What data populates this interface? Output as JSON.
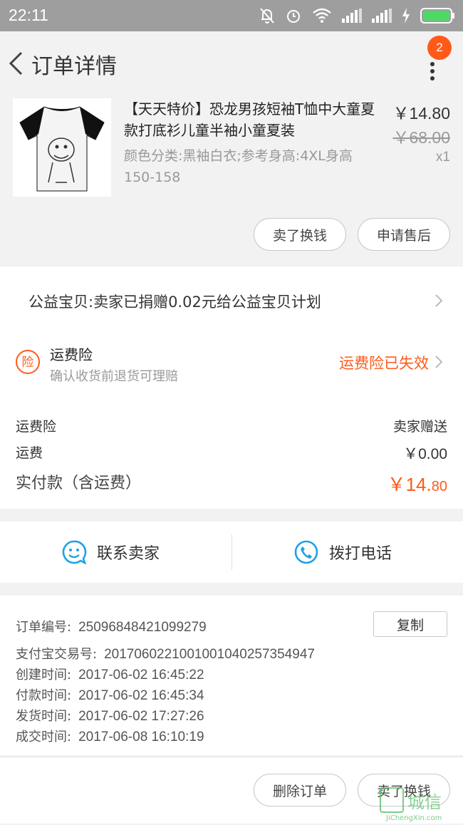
{
  "status_bar": {
    "time": "22:11"
  },
  "header": {
    "title": "订单详情",
    "badge_count": "2"
  },
  "product": {
    "title": "【天天特价】恐龙男孩短袖T恤中大童夏款打底衫儿童半袖小童夏装",
    "sku": "颜色分类:黑袖白衣;参考身高:4XL身高150-158",
    "price_now": "￥14.80",
    "price_old": "￥68.00",
    "quantity": "x1",
    "btn_sell": "卖了换钱",
    "btn_after_sale": "申请售后"
  },
  "charity": {
    "text": "公益宝贝:卖家已捐赠0.02元给公益宝贝计划"
  },
  "insurance": {
    "icon_char": "险",
    "title": "运费险",
    "subtitle": "确认收货前退货可理赔",
    "status": "运费险已失效",
    "status_color": "#ff5a1a"
  },
  "fees": {
    "rows": [
      {
        "label": "运费险",
        "value": "卖家赠送"
      },
      {
        "label": "运费",
        "value": "￥0.00"
      }
    ],
    "total_label": "实付款（含运费）",
    "total_value_main": "￥14.",
    "total_value_cents": "80"
  },
  "contact": {
    "seller_label": "联系卖家",
    "call_label": "拨打电话",
    "icon_color": "#1ea1e6"
  },
  "order_info": {
    "order_no_label": "订单编号:",
    "order_no": "25096848421099279",
    "copy_label": "复制",
    "rows": [
      {
        "label": "支付宝交易号:",
        "value": "2017060221001001040257354947"
      },
      {
        "label": "创建时间:",
        "value": "2017-06-02 16:45:22"
      },
      {
        "label": "付款时间:",
        "value": "2017-06-02 16:45:34"
      },
      {
        "label": "发货时间:",
        "value": "2017-06-02 17:27:26"
      },
      {
        "label": "成交时间:",
        "value": "2017-06-08 16:10:19"
      }
    ]
  },
  "footer": {
    "btn_delete": "删除订单",
    "btn_sell": "卖了换钱"
  },
  "watermark": {
    "text": "JiChengXin.com",
    "logo_text": "城信"
  }
}
